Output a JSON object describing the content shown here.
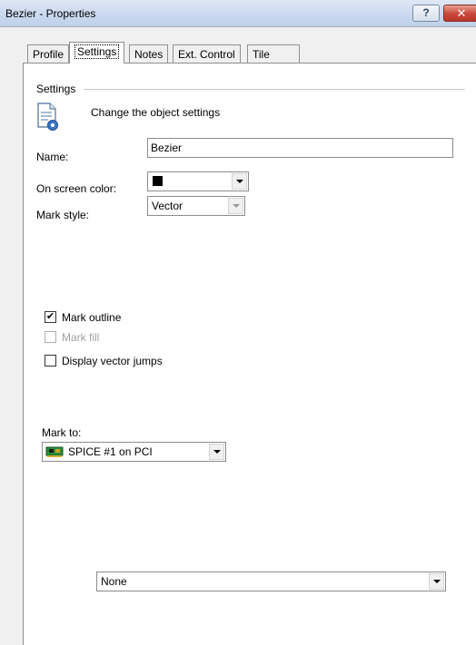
{
  "window": {
    "title": "Bezier - Properties",
    "help_glyph": "?",
    "close_glyph": "✕"
  },
  "tabs": [
    {
      "label": "Profile",
      "active": false
    },
    {
      "label": "Settings",
      "active": true
    },
    {
      "label": "Notes",
      "active": false
    },
    {
      "label": "Ext. Control",
      "active": false
    },
    {
      "label": "Tile",
      "active": false
    }
  ],
  "settings": {
    "group_label": "Settings",
    "description": "Change the object settings",
    "name_label": "Name:",
    "name_value": "Bezier",
    "color_label": "On screen color:",
    "color_value": "#000000",
    "mark_style_label": "Mark style:",
    "mark_style_value": "Vector",
    "mark_outline_label": "Mark outline",
    "mark_outline_checked": true,
    "mark_fill_label": "Mark fill",
    "mark_fill_checked": false,
    "display_vector_jumps_label": "Display vector jumps",
    "display_vector_jumps_checked": false,
    "mark_to_label": "Mark to:",
    "mark_to_value": "SPICE #1 on PCI",
    "bottom_select_value": "None"
  }
}
